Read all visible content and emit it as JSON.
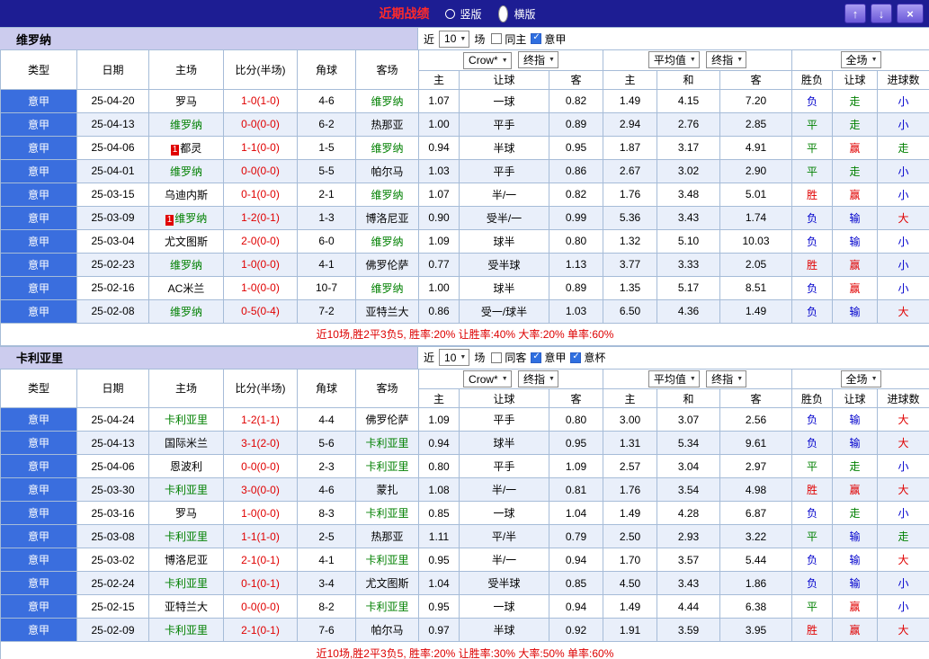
{
  "titlebar": {
    "title": "近期战绩",
    "radios": [
      {
        "label": "竖版",
        "selected": false
      },
      {
        "label": "横版",
        "selected": true
      }
    ],
    "buttons": {
      "up": "↑",
      "down": "↓",
      "close": "×"
    }
  },
  "columns": {
    "type": "类型",
    "date": "日期",
    "home": "主场",
    "score": "比分(半场)",
    "corner": "角球",
    "away": "客场",
    "group1_select1": "Crow*",
    "group1_select2": "终指",
    "group1_sub": [
      "主",
      "让球",
      "客"
    ],
    "group2_select1": "平均值",
    "group2_select2": "终指",
    "group2_sub": [
      "主",
      "和",
      "客"
    ],
    "group3_select": "全场",
    "group3_sub": [
      "胜负",
      "让球",
      "进球数"
    ]
  },
  "colors": {
    "titlebar_bg": "#1d1d93",
    "title_text": "#ff2a2a",
    "section_head_bg": "#ccccee",
    "league_cell_bg": "#3a6ede",
    "focus_team": "#008000",
    "score_text": "#e00000",
    "win_text": "#e00000",
    "draw_text": "#008000",
    "lose_text": "#0000cc",
    "grid_border": "#a6bcd8",
    "alt_row_bg": "#e9effa",
    "button_bg": "#6a58d8"
  },
  "sections": [
    {
      "team": "维罗纳",
      "controls": {
        "near_label": "近",
        "count": "10",
        "games_label": "场",
        "checks": [
          {
            "label": "同主",
            "checked": false
          },
          {
            "label": "意甲",
            "checked": true
          }
        ]
      },
      "rows": [
        {
          "league": "意甲",
          "date": "25-04-20",
          "home": "罗马",
          "home_badge": "",
          "home_focus": false,
          "score": "1-0(1-0)",
          "corner": "4-6",
          "away": "维罗纳",
          "away_badge": "",
          "away_focus": true,
          "let_home": "1.07",
          "handicap": "一球",
          "let_away": "0.82",
          "avg_home": "1.49",
          "avg_draw": "4.15",
          "avg_away": "7.20",
          "res_wdl": "负",
          "res_let": "走",
          "res_goal": "小"
        },
        {
          "league": "意甲",
          "date": "25-04-13",
          "home": "维罗纳",
          "home_badge": "",
          "home_focus": true,
          "score": "0-0(0-0)",
          "corner": "6-2",
          "away": "热那亚",
          "away_badge": "",
          "away_focus": false,
          "let_home": "1.00",
          "handicap": "平手",
          "let_away": "0.89",
          "avg_home": "2.94",
          "avg_draw": "2.76",
          "avg_away": "2.85",
          "res_wdl": "平",
          "res_let": "走",
          "res_goal": "小"
        },
        {
          "league": "意甲",
          "date": "25-04-06",
          "home": "都灵",
          "home_badge": "1",
          "home_focus": false,
          "score": "1-1(0-0)",
          "corner": "1-5",
          "away": "维罗纳",
          "away_badge": "",
          "away_focus": true,
          "let_home": "0.94",
          "handicap": "半球",
          "let_away": "0.95",
          "avg_home": "1.87",
          "avg_draw": "3.17",
          "avg_away": "4.91",
          "res_wdl": "平",
          "res_let": "赢",
          "res_goal": "走"
        },
        {
          "league": "意甲",
          "date": "25-04-01",
          "home": "维罗纳",
          "home_badge": "",
          "home_focus": true,
          "score": "0-0(0-0)",
          "corner": "5-5",
          "away": "帕尔马",
          "away_badge": "",
          "away_focus": false,
          "let_home": "1.03",
          "handicap": "平手",
          "let_away": "0.86",
          "avg_home": "2.67",
          "avg_draw": "3.02",
          "avg_away": "2.90",
          "res_wdl": "平",
          "res_let": "走",
          "res_goal": "小"
        },
        {
          "league": "意甲",
          "date": "25-03-15",
          "home": "乌迪内斯",
          "home_badge": "",
          "home_focus": false,
          "score": "0-1(0-0)",
          "corner": "2-1",
          "away": "维罗纳",
          "away_badge": "",
          "away_focus": true,
          "let_home": "1.07",
          "handicap": "半/一",
          "let_away": "0.82",
          "avg_home": "1.76",
          "avg_draw": "3.48",
          "avg_away": "5.01",
          "res_wdl": "胜",
          "res_let": "赢",
          "res_goal": "小"
        },
        {
          "league": "意甲",
          "date": "25-03-09",
          "home": "维罗纳",
          "home_badge": "1",
          "home_focus": true,
          "score": "1-2(0-1)",
          "corner": "1-3",
          "away": "博洛尼亚",
          "away_badge": "",
          "away_focus": false,
          "let_home": "0.90",
          "handicap": "受半/一",
          "let_away": "0.99",
          "avg_home": "5.36",
          "avg_draw": "3.43",
          "avg_away": "1.74",
          "res_wdl": "负",
          "res_let": "输",
          "res_goal": "大"
        },
        {
          "league": "意甲",
          "date": "25-03-04",
          "home": "尤文图斯",
          "home_badge": "",
          "home_focus": false,
          "score": "2-0(0-0)",
          "corner": "6-0",
          "away": "维罗纳",
          "away_badge": "",
          "away_focus": true,
          "let_home": "1.09",
          "handicap": "球半",
          "let_away": "0.80",
          "avg_home": "1.32",
          "avg_draw": "5.10",
          "avg_away": "10.03",
          "res_wdl": "负",
          "res_let": "输",
          "res_goal": "小"
        },
        {
          "league": "意甲",
          "date": "25-02-23",
          "home": "维罗纳",
          "home_badge": "",
          "home_focus": true,
          "score": "1-0(0-0)",
          "corner": "4-1",
          "away": "佛罗伦萨",
          "away_badge": "",
          "away_focus": false,
          "let_home": "0.77",
          "handicap": "受半球",
          "let_away": "1.13",
          "avg_home": "3.77",
          "avg_draw": "3.33",
          "avg_away": "2.05",
          "res_wdl": "胜",
          "res_let": "赢",
          "res_goal": "小"
        },
        {
          "league": "意甲",
          "date": "25-02-16",
          "home": "AC米兰",
          "home_badge": "",
          "home_focus": false,
          "score": "1-0(0-0)",
          "corner": "10-7",
          "away": "维罗纳",
          "away_badge": "",
          "away_focus": true,
          "let_home": "1.00",
          "handicap": "球半",
          "let_away": "0.89",
          "avg_home": "1.35",
          "avg_draw": "5.17",
          "avg_away": "8.51",
          "res_wdl": "负",
          "res_let": "赢",
          "res_goal": "小"
        },
        {
          "league": "意甲",
          "date": "25-02-08",
          "home": "维罗纳",
          "home_badge": "",
          "home_focus": true,
          "score": "0-5(0-4)",
          "corner": "7-2",
          "away": "亚特兰大",
          "away_badge": "",
          "away_focus": false,
          "let_home": "0.86",
          "handicap": "受一/球半",
          "let_away": "1.03",
          "avg_home": "6.50",
          "avg_draw": "4.36",
          "avg_away": "1.49",
          "res_wdl": "负",
          "res_let": "输",
          "res_goal": "大"
        }
      ],
      "summary": "近10场,胜2平3负5, 胜率:20% 让胜率:40% 大率:20% 单率:60%"
    },
    {
      "team": "卡利亚里",
      "controls": {
        "near_label": "近",
        "count": "10",
        "games_label": "场",
        "checks": [
          {
            "label": "同客",
            "checked": false
          },
          {
            "label": "意甲",
            "checked": true
          },
          {
            "label": "意杯",
            "checked": true
          }
        ]
      },
      "rows": [
        {
          "league": "意甲",
          "date": "25-04-24",
          "home": "卡利亚里",
          "home_badge": "",
          "home_focus": true,
          "score": "1-2(1-1)",
          "corner": "4-4",
          "away": "佛罗伦萨",
          "away_badge": "",
          "away_focus": false,
          "let_home": "1.09",
          "handicap": "平手",
          "let_away": "0.80",
          "avg_home": "3.00",
          "avg_draw": "3.07",
          "avg_away": "2.56",
          "res_wdl": "负",
          "res_let": "输",
          "res_goal": "大"
        },
        {
          "league": "意甲",
          "date": "25-04-13",
          "home": "国际米兰",
          "home_badge": "",
          "home_focus": false,
          "score": "3-1(2-0)",
          "corner": "5-6",
          "away": "卡利亚里",
          "away_badge": "",
          "away_focus": true,
          "let_home": "0.94",
          "handicap": "球半",
          "let_away": "0.95",
          "avg_home": "1.31",
          "avg_draw": "5.34",
          "avg_away": "9.61",
          "res_wdl": "负",
          "res_let": "输",
          "res_goal": "大"
        },
        {
          "league": "意甲",
          "date": "25-04-06",
          "home": "恩波利",
          "home_badge": "",
          "home_focus": false,
          "score": "0-0(0-0)",
          "corner": "2-3",
          "away": "卡利亚里",
          "away_badge": "",
          "away_focus": true,
          "let_home": "0.80",
          "handicap": "平手",
          "let_away": "1.09",
          "avg_home": "2.57",
          "avg_draw": "3.04",
          "avg_away": "2.97",
          "res_wdl": "平",
          "res_let": "走",
          "res_goal": "小"
        },
        {
          "league": "意甲",
          "date": "25-03-30",
          "home": "卡利亚里",
          "home_badge": "",
          "home_focus": true,
          "score": "3-0(0-0)",
          "corner": "4-6",
          "away": "蒙扎",
          "away_badge": "",
          "away_focus": false,
          "let_home": "1.08",
          "handicap": "半/一",
          "let_away": "0.81",
          "avg_home": "1.76",
          "avg_draw": "3.54",
          "avg_away": "4.98",
          "res_wdl": "胜",
          "res_let": "赢",
          "res_goal": "大"
        },
        {
          "league": "意甲",
          "date": "25-03-16",
          "home": "罗马",
          "home_badge": "",
          "home_focus": false,
          "score": "1-0(0-0)",
          "corner": "8-3",
          "away": "卡利亚里",
          "away_badge": "",
          "away_focus": true,
          "let_home": "0.85",
          "handicap": "一球",
          "let_away": "1.04",
          "avg_home": "1.49",
          "avg_draw": "4.28",
          "avg_away": "6.87",
          "res_wdl": "负",
          "res_let": "走",
          "res_goal": "小"
        },
        {
          "league": "意甲",
          "date": "25-03-08",
          "home": "卡利亚里",
          "home_badge": "",
          "home_focus": true,
          "score": "1-1(1-0)",
          "corner": "2-5",
          "away": "热那亚",
          "away_badge": "",
          "away_focus": false,
          "let_home": "1.11",
          "handicap": "平/半",
          "let_away": "0.79",
          "avg_home": "2.50",
          "avg_draw": "2.93",
          "avg_away": "3.22",
          "res_wdl": "平",
          "res_let": "输",
          "res_goal": "走"
        },
        {
          "league": "意甲",
          "date": "25-03-02",
          "home": "博洛尼亚",
          "home_badge": "",
          "home_focus": false,
          "score": "2-1(0-1)",
          "corner": "4-1",
          "away": "卡利亚里",
          "away_badge": "",
          "away_focus": true,
          "let_home": "0.95",
          "handicap": "半/一",
          "let_away": "0.94",
          "avg_home": "1.70",
          "avg_draw": "3.57",
          "avg_away": "5.44",
          "res_wdl": "负",
          "res_let": "输",
          "res_goal": "大"
        },
        {
          "league": "意甲",
          "date": "25-02-24",
          "home": "卡利亚里",
          "home_badge": "",
          "home_focus": true,
          "score": "0-1(0-1)",
          "corner": "3-4",
          "away": "尤文图斯",
          "away_badge": "",
          "away_focus": false,
          "let_home": "1.04",
          "handicap": "受半球",
          "let_away": "0.85",
          "avg_home": "4.50",
          "avg_draw": "3.43",
          "avg_away": "1.86",
          "res_wdl": "负",
          "res_let": "输",
          "res_goal": "小"
        },
        {
          "league": "意甲",
          "date": "25-02-15",
          "home": "亚特兰大",
          "home_badge": "",
          "home_focus": false,
          "score": "0-0(0-0)",
          "corner": "8-2",
          "away": "卡利亚里",
          "away_badge": "",
          "away_focus": true,
          "let_home": "0.95",
          "handicap": "一球",
          "let_away": "0.94",
          "avg_home": "1.49",
          "avg_draw": "4.44",
          "avg_away": "6.38",
          "res_wdl": "平",
          "res_let": "赢",
          "res_goal": "小"
        },
        {
          "league": "意甲",
          "date": "25-02-09",
          "home": "卡利亚里",
          "home_badge": "",
          "home_focus": true,
          "score": "2-1(0-1)",
          "corner": "7-6",
          "away": "帕尔马",
          "away_badge": "",
          "away_focus": false,
          "let_home": "0.97",
          "handicap": "半球",
          "let_away": "0.92",
          "avg_home": "1.91",
          "avg_draw": "3.59",
          "avg_away": "3.95",
          "res_wdl": "胜",
          "res_let": "赢",
          "res_goal": "大"
        }
      ],
      "summary": "近10场,胜2平3负5, 胜率:20% 让胜率:30% 大率:50% 单率:60%"
    }
  ]
}
